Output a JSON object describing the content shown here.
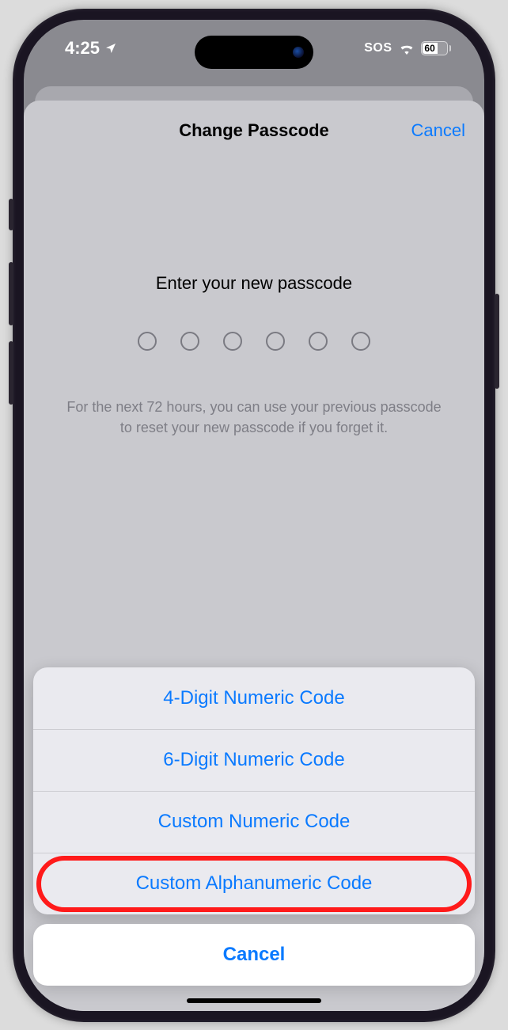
{
  "status": {
    "time": "4:25",
    "sos": "SOS",
    "battery": "60"
  },
  "sheet": {
    "title": "Change Passcode",
    "cancel": "Cancel"
  },
  "passcode": {
    "prompt": "Enter your new passcode",
    "dot_count": 6,
    "hint": "For the next 72 hours, you can use your previous passcode to reset your new passcode if you forget it."
  },
  "action_sheet": {
    "options": [
      "4-Digit Numeric Code",
      "6-Digit Numeric Code",
      "Custom Numeric Code",
      "Custom Alphanumeric Code"
    ],
    "cancel": "Cancel",
    "highlighted_index": 3
  }
}
